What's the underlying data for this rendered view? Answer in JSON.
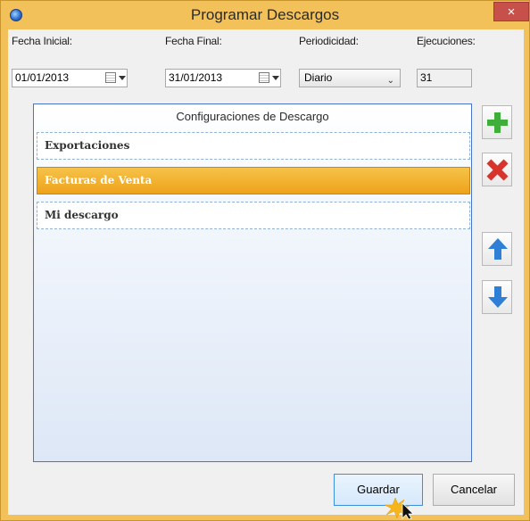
{
  "window": {
    "title": "Programar Descargos",
    "close_glyph": "×"
  },
  "form": {
    "fecha_inicial": {
      "label": "Fecha Inicial:",
      "value": "01/01/2013"
    },
    "fecha_final": {
      "label": "Fecha Final:",
      "value": "31/01/2013"
    },
    "periodicidad": {
      "label": "Periodicidad:",
      "value": "Diario"
    },
    "ejecuciones": {
      "label": "Ejecuciones:",
      "value": "31"
    }
  },
  "list": {
    "header": "Configuraciones de Descargo",
    "items": [
      {
        "label": "Exportaciones",
        "selected": false
      },
      {
        "label": "Facturas de Venta",
        "selected": true
      },
      {
        "label": "Mi descargo",
        "selected": false
      }
    ]
  },
  "side_buttons": {
    "add_icon": "plus-icon",
    "delete_icon": "x-icon",
    "up_icon": "arrow-up-icon",
    "down_icon": "arrow-down-icon"
  },
  "footer": {
    "save_label": "Guardar",
    "cancel_label": "Cancelar"
  },
  "colors": {
    "frame": "#f2c15a",
    "selection": "#eea21a",
    "add": "#3fae3a",
    "delete": "#d9342b",
    "move": "#2f7fd6"
  }
}
